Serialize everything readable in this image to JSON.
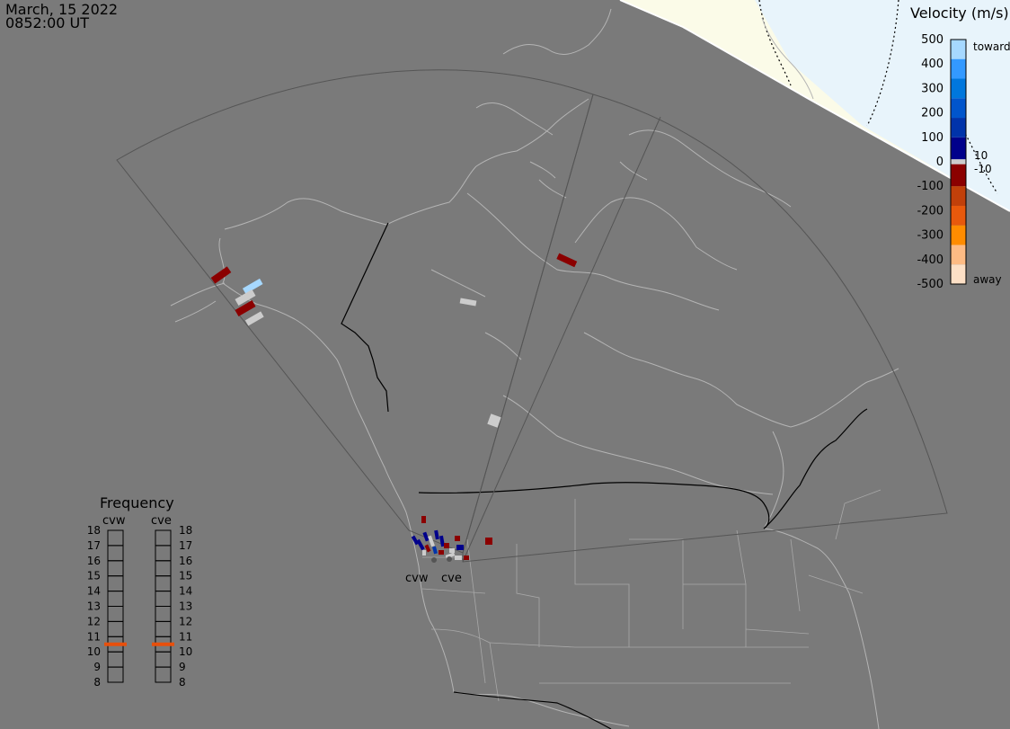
{
  "header": {
    "date": "March, 15 2022",
    "time": "0852:00 UT"
  },
  "colorbar": {
    "title": "Velocity (m/s)",
    "ticks": [
      {
        "label": "500",
        "value": 500
      },
      {
        "label": "400",
        "value": 400
      },
      {
        "label": "300",
        "value": 300
      },
      {
        "label": "200",
        "value": 200
      },
      {
        "label": "100",
        "value": 100
      },
      {
        "label": "0",
        "value": 0
      },
      {
        "label": "-100",
        "value": -100
      },
      {
        "label": "-200",
        "value": -200
      },
      {
        "label": "-300",
        "value": -300
      },
      {
        "label": "-400",
        "value": -400
      },
      {
        "label": "-500",
        "value": -500
      }
    ],
    "toward_label": "toward",
    "away_label": "away",
    "pos_threshold_label": "10",
    "neg_threshold_label": "-10",
    "colors": [
      "#fde0c6",
      "#fdbb84",
      "#ff8c00",
      "#e8590c",
      "#c1400a",
      "#8b0000",
      "#cccccc",
      "#00008b",
      "#0033aa",
      "#0055cc",
      "#0077dd",
      "#3399ff",
      "#a6d8ff"
    ]
  },
  "frequency": {
    "title": "Frequency",
    "min": 8,
    "max": 18,
    "tick_labels": [
      "18",
      "17",
      "16",
      "15",
      "14",
      "13",
      "12",
      "11",
      "10",
      "9",
      "8"
    ],
    "radars": [
      {
        "label": "cvw",
        "value": 10.5
      },
      {
        "label": "cve",
        "value": 10.5
      }
    ],
    "marker_color": "#e8500c"
  },
  "radar_sites": [
    {
      "label": "cvw"
    },
    {
      "label": "cve"
    }
  ],
  "colors": {
    "background": "#7a7a7a",
    "daylight": "#fbfbe8",
    "sunlit_sea": "#e8f4fb",
    "coast": "#b4b4b4",
    "border": "#000000",
    "fov": "#555555"
  }
}
